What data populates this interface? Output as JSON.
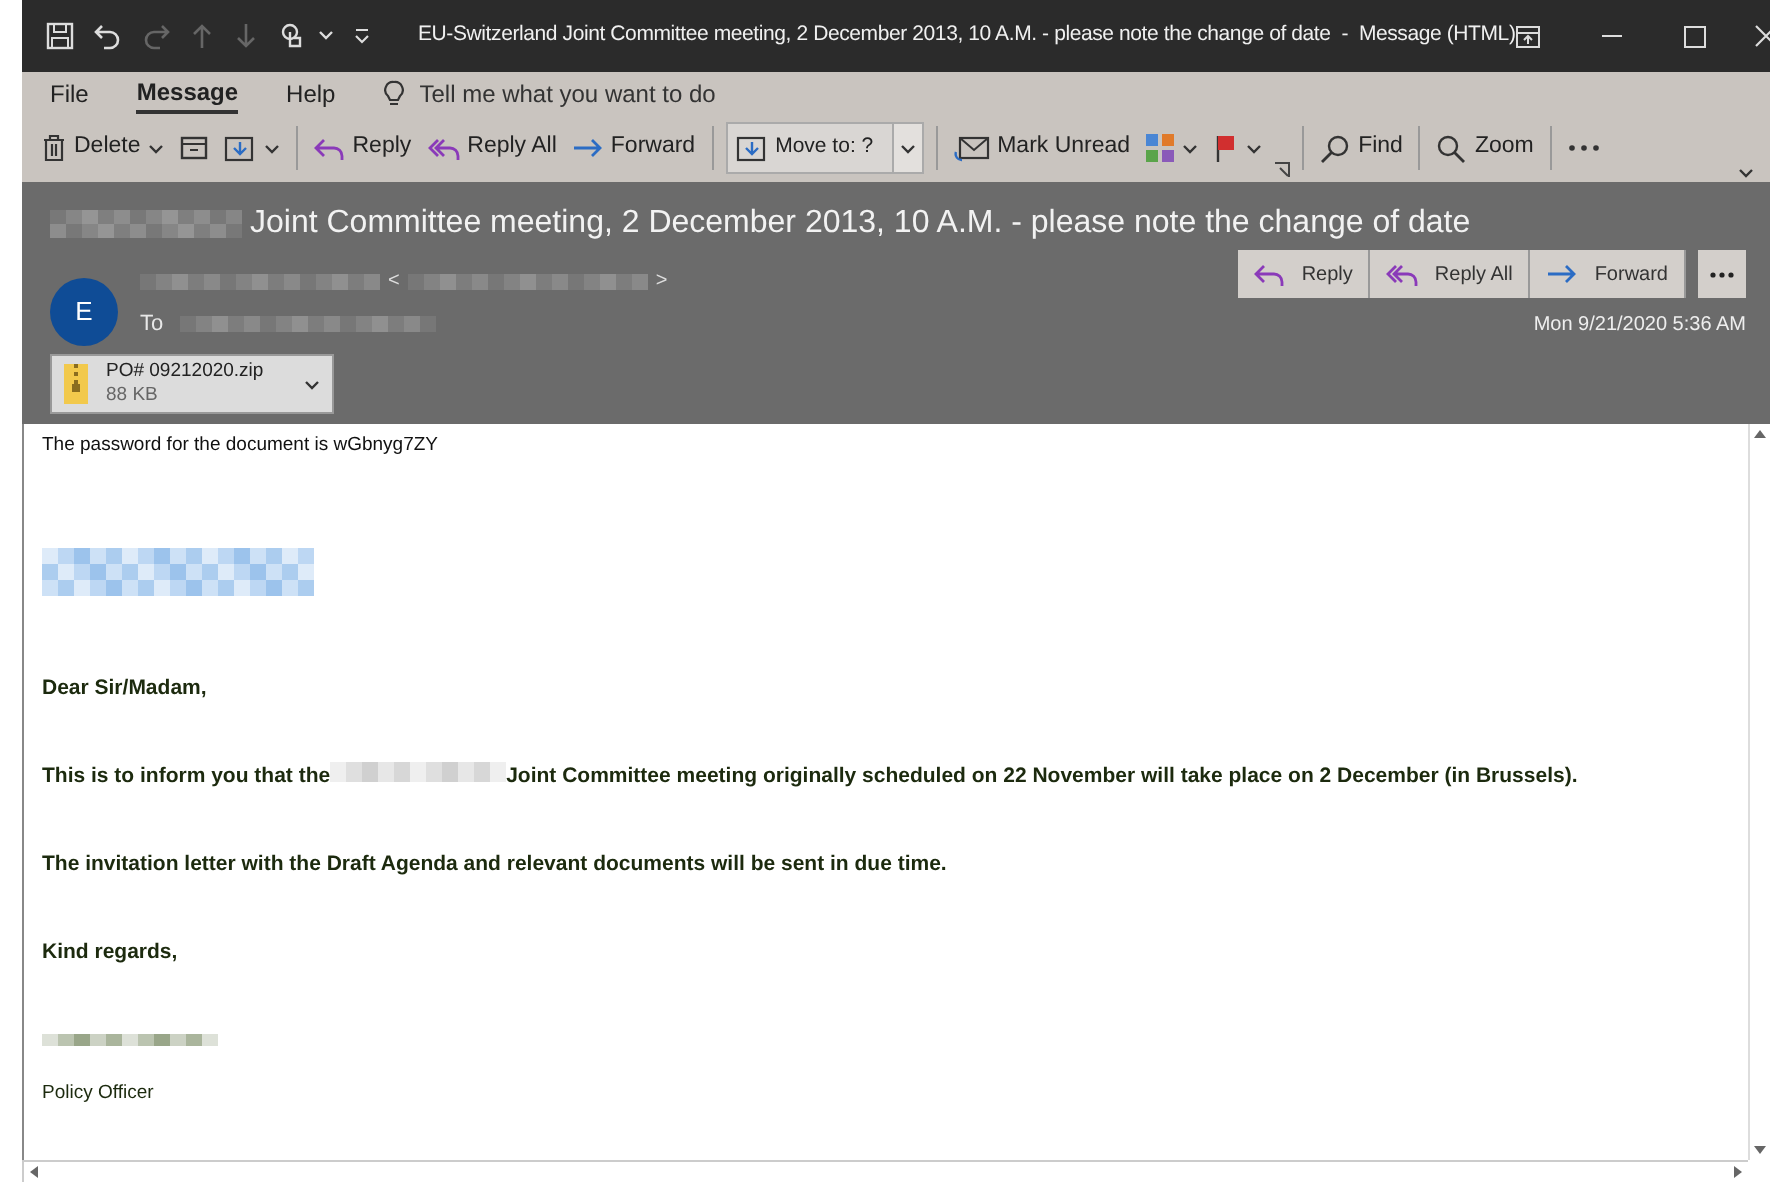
{
  "window": {
    "title": "EU-Switzerland Joint Committee meeting, 2 December 2013, 10 A.M. - please note the change of date  -  Message (HTML)"
  },
  "menu": {
    "tabs": [
      {
        "label": "File",
        "selected": false
      },
      {
        "label": "Message",
        "selected": true
      },
      {
        "label": "Help",
        "selected": false
      }
    ],
    "tell_me": "Tell me what you want to do"
  },
  "toolbar": {
    "delete": "Delete",
    "reply": "Reply",
    "reply_all": "Reply All",
    "forward": "Forward",
    "move_to": "Move to: ?",
    "mark_unread": "Mark Unread",
    "find": "Find",
    "zoom": "Zoom"
  },
  "header": {
    "subject": "Joint Committee meeting, 2 December 2013, 10 A.M. - please note the change of date",
    "avatar_initial": "E",
    "address_open": "<",
    "address_close": ">",
    "to_label": "To",
    "actions": [
      "Reply",
      "Reply All",
      "Forward"
    ],
    "date": "Mon 9/21/2020 5:36 AM",
    "attachment": {
      "name": "PO# 09212020.zip",
      "size": "88 KB"
    }
  },
  "body": [
    {
      "kind": "plain",
      "text": "The password for the document is wGbnyg7ZY"
    },
    {
      "kind": "redacted_logo"
    },
    {
      "kind": "bold",
      "text": "Dear Sir/Madam,"
    },
    {
      "kind": "bold_redacted",
      "before": "This is to inform you that the",
      "after": "Joint Committee meeting originally scheduled on 22 November will take place on 2 December (in Brussels)."
    },
    {
      "kind": "bold",
      "text": "The invitation letter with the Draft Agenda and relevant documents will be sent in due time."
    },
    {
      "kind": "bold",
      "text": "Kind regards,"
    },
    {
      "kind": "redacted_name"
    },
    {
      "kind": "signature",
      "text": "Policy Officer"
    }
  ]
}
